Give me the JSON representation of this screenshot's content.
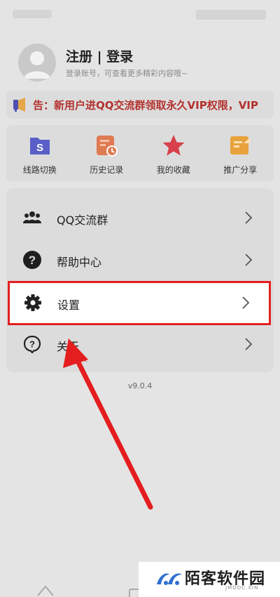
{
  "profile": {
    "title": "注册 | 登录",
    "subtitle": "登录账号，可查看更多精彩内容哦~",
    "avatar_icon": "user-avatar-icon"
  },
  "notice": {
    "icon": "megaphone-icon",
    "text": "告：新用户进QQ交流群领取永久VIP权限，VIP"
  },
  "quick_actions": [
    {
      "label": "线路切换",
      "icon": "route-switch-icon",
      "color": "#5a5fc8"
    },
    {
      "label": "历史记录",
      "icon": "history-icon",
      "color": "#e07a52"
    },
    {
      "label": "我的收藏",
      "icon": "star-icon",
      "color": "#d8404a"
    },
    {
      "label": "推广分享",
      "icon": "share-icon",
      "color": "#e8a23c"
    }
  ],
  "menu": [
    {
      "label": "QQ交流群",
      "icon": "group-icon"
    },
    {
      "label": "帮助中心",
      "icon": "help-icon"
    },
    {
      "label": "设置",
      "icon": "gear-icon"
    },
    {
      "label": "关于",
      "icon": "about-icon"
    }
  ],
  "version": "v9.0.4",
  "watermark": {
    "text": "陌客软件园",
    "sub": "JMOOC.XIN"
  },
  "colors": {
    "notice_text": "#b3312e",
    "highlight_border": "#e41e1e",
    "arrow": "#e41e1e"
  }
}
